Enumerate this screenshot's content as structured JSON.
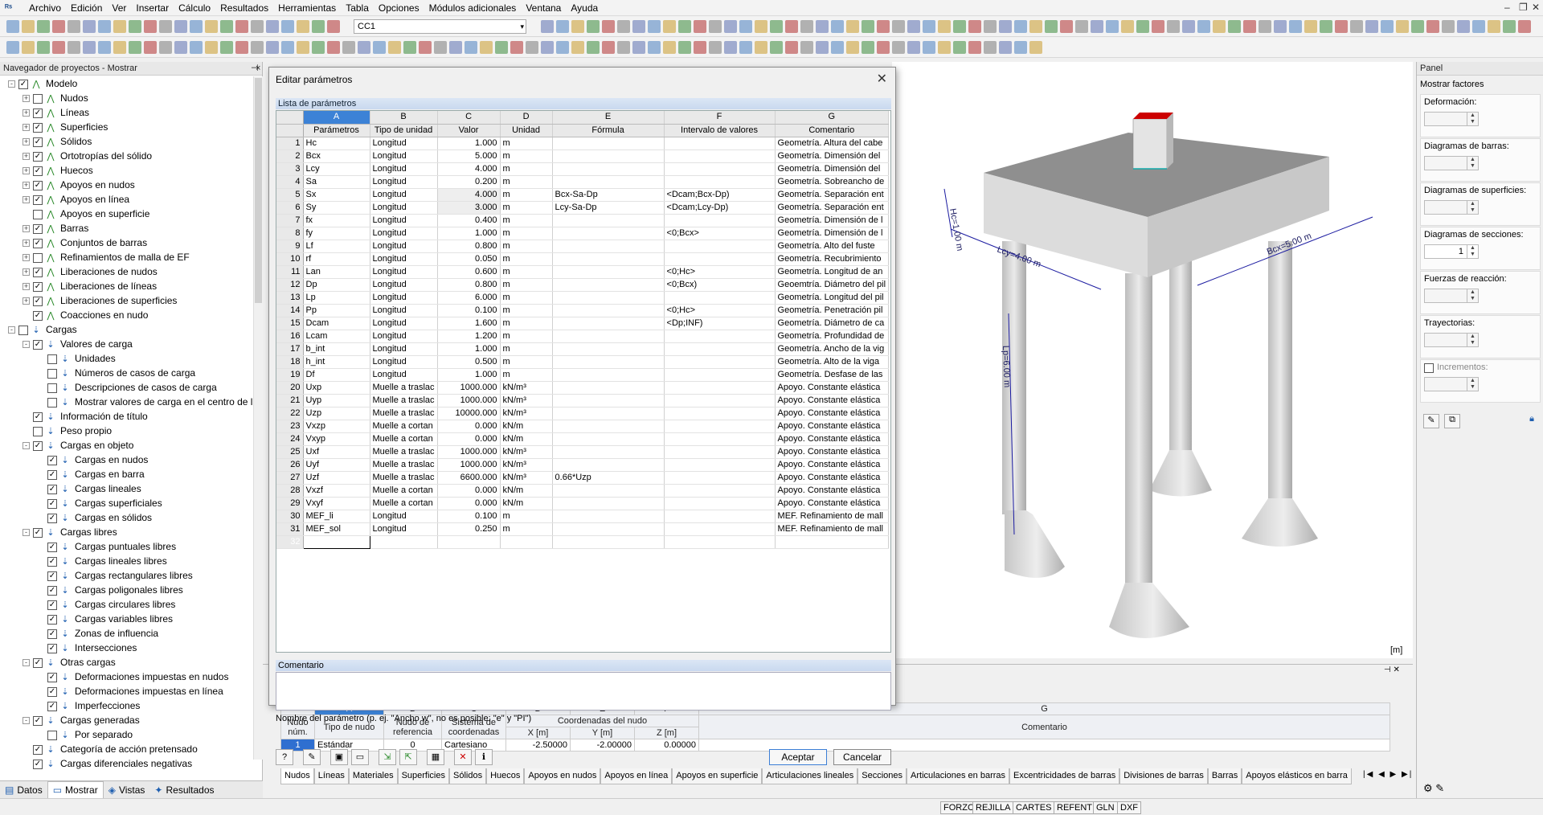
{
  "menu": {
    "items": [
      "Archivo",
      "Edición",
      "Ver",
      "Insertar",
      "Cálculo",
      "Resultados",
      "Herramientas",
      "Tabla",
      "Opciones",
      "Módulos adicionales",
      "Ventana",
      "Ayuda"
    ]
  },
  "toolbar": {
    "load_case": "CC1"
  },
  "nav": {
    "title": "Navegador de proyectos - Mostrar",
    "items": [
      {
        "l": "Modelo",
        "lv": 0,
        "e": "-",
        "c": "✓",
        "ic": "gr"
      },
      {
        "l": "Nudos",
        "lv": 1,
        "e": "+",
        "c": "",
        "ic": "gr"
      },
      {
        "l": "Líneas",
        "lv": 1,
        "e": "+",
        "c": "✓",
        "ic": "gr"
      },
      {
        "l": "Superficies",
        "lv": 1,
        "e": "+",
        "c": "✓",
        "ic": "gr"
      },
      {
        "l": "Sólidos",
        "lv": 1,
        "e": "+",
        "c": "✓",
        "ic": "gr"
      },
      {
        "l": "Ortotropías del sólido",
        "lv": 1,
        "e": "+",
        "c": "✓",
        "ic": "gr"
      },
      {
        "l": "Huecos",
        "lv": 1,
        "e": "+",
        "c": "✓",
        "ic": "gr"
      },
      {
        "l": "Apoyos en nudos",
        "lv": 1,
        "e": "+",
        "c": "✓",
        "ic": "gr"
      },
      {
        "l": "Apoyos en línea",
        "lv": 1,
        "e": "+",
        "c": "✓",
        "ic": "gr"
      },
      {
        "l": "Apoyos en superficie",
        "lv": 1,
        "e": "",
        "c": "",
        "ic": "gr"
      },
      {
        "l": "Barras",
        "lv": 1,
        "e": "+",
        "c": "✓",
        "ic": "gr"
      },
      {
        "l": "Conjuntos de barras",
        "lv": 1,
        "e": "+",
        "c": "✓",
        "ic": "gr"
      },
      {
        "l": "Refinamientos de malla de EF",
        "lv": 1,
        "e": "+",
        "c": "",
        "ic": "gr"
      },
      {
        "l": "Liberaciones de nudos",
        "lv": 1,
        "e": "+",
        "c": "✓",
        "ic": "gr"
      },
      {
        "l": "Liberaciones de líneas",
        "lv": 1,
        "e": "+",
        "c": "✓",
        "ic": "gr"
      },
      {
        "l": "Liberaciones de superficies",
        "lv": 1,
        "e": "+",
        "c": "✓",
        "ic": "gr"
      },
      {
        "l": "Coacciones en nudo",
        "lv": 1,
        "e": "",
        "c": "✓",
        "ic": "gr"
      },
      {
        "l": "Cargas",
        "lv": 0,
        "e": "-",
        "c": "",
        "ic": "bl"
      },
      {
        "l": "Valores de carga",
        "lv": 1,
        "e": "-",
        "c": "✓",
        "ic": "bl"
      },
      {
        "l": "Unidades",
        "lv": 2,
        "e": "",
        "c": "",
        "ic": "bl"
      },
      {
        "l": "Números de casos de carga",
        "lv": 2,
        "e": "",
        "c": "",
        "ic": "bl"
      },
      {
        "l": "Descripciones de casos de carga",
        "lv": 2,
        "e": "",
        "c": "",
        "ic": "bl"
      },
      {
        "l": "Mostrar valores de carga en el centro de la",
        "lv": 2,
        "e": "",
        "c": "",
        "ic": "bl"
      },
      {
        "l": "Información de título",
        "lv": 1,
        "e": "",
        "c": "✓",
        "ic": "bl"
      },
      {
        "l": "Peso propio",
        "lv": 1,
        "e": "",
        "c": "",
        "ic": "bl"
      },
      {
        "l": "Cargas en objeto",
        "lv": 1,
        "e": "-",
        "c": "✓",
        "ic": "bl"
      },
      {
        "l": "Cargas en nudos",
        "lv": 2,
        "e": "",
        "c": "✓",
        "ic": "bl"
      },
      {
        "l": "Cargas en barra",
        "lv": 2,
        "e": "",
        "c": "✓",
        "ic": "bl"
      },
      {
        "l": "Cargas lineales",
        "lv": 2,
        "e": "",
        "c": "✓",
        "ic": "bl"
      },
      {
        "l": "Cargas superficiales",
        "lv": 2,
        "e": "",
        "c": "✓",
        "ic": "bl"
      },
      {
        "l": "Cargas en sólidos",
        "lv": 2,
        "e": "",
        "c": "✓",
        "ic": "bl"
      },
      {
        "l": "Cargas libres",
        "lv": 1,
        "e": "-",
        "c": "✓",
        "ic": "bl"
      },
      {
        "l": "Cargas puntuales libres",
        "lv": 2,
        "e": "",
        "c": "✓",
        "ic": "bl"
      },
      {
        "l": "Cargas lineales libres",
        "lv": 2,
        "e": "",
        "c": "✓",
        "ic": "bl"
      },
      {
        "l": "Cargas rectangulares libres",
        "lv": 2,
        "e": "",
        "c": "✓",
        "ic": "bl"
      },
      {
        "l": "Cargas poligonales libres",
        "lv": 2,
        "e": "",
        "c": "✓",
        "ic": "bl"
      },
      {
        "l": "Cargas circulares libres",
        "lv": 2,
        "e": "",
        "c": "✓",
        "ic": "bl"
      },
      {
        "l": "Cargas variables libres",
        "lv": 2,
        "e": "",
        "c": "✓",
        "ic": "bl"
      },
      {
        "l": "Zonas de influencia",
        "lv": 2,
        "e": "",
        "c": "✓",
        "ic": "bl"
      },
      {
        "l": "Intersecciones",
        "lv": 2,
        "e": "",
        "c": "✓",
        "ic": "bl"
      },
      {
        "l": "Otras cargas",
        "lv": 1,
        "e": "-",
        "c": "✓",
        "ic": "bl"
      },
      {
        "l": "Deformaciones impuestas en nudos",
        "lv": 2,
        "e": "",
        "c": "✓",
        "ic": "bl"
      },
      {
        "l": "Deformaciones impuestas en línea",
        "lv": 2,
        "e": "",
        "c": "✓",
        "ic": "bl"
      },
      {
        "l": "Imperfecciones",
        "lv": 2,
        "e": "",
        "c": "✓",
        "ic": "bl"
      },
      {
        "l": "Cargas generadas",
        "lv": 1,
        "e": "-",
        "c": "✓",
        "ic": "bl"
      },
      {
        "l": "Por separado",
        "lv": 2,
        "e": "",
        "c": "",
        "ic": "bl"
      },
      {
        "l": "Categoría de acción pretensado",
        "lv": 1,
        "e": "",
        "c": "✓",
        "ic": "bl"
      },
      {
        "l": "Cargas diferenciales negativas",
        "lv": 1,
        "e": "",
        "c": "✓",
        "ic": "bl"
      }
    ],
    "tabs": [
      "Datos",
      "Mostrar",
      "Vistas",
      "Resultados"
    ]
  },
  "dialog": {
    "title": "Editar parámetros",
    "list_header": "Lista de parámetros",
    "col_letters": [
      "A",
      "B",
      "C",
      "D",
      "E",
      "F",
      "G"
    ],
    "col_names": [
      "Parámetros",
      "Tipo de unidad",
      "Valor",
      "Unidad",
      "Fórmula",
      "Intervalo de valores",
      "Comentario"
    ],
    "rows": [
      [
        "1",
        "Hc",
        "Longitud",
        "1.000",
        "m",
        "",
        "",
        "Geometría. Altura del cabe"
      ],
      [
        "2",
        "Bcx",
        "Longitud",
        "5.000",
        "m",
        "",
        "",
        "Geometría. Dimensión del"
      ],
      [
        "3",
        "Lcy",
        "Longitud",
        "4.000",
        "m",
        "",
        "",
        "Geometría. Dimensión del"
      ],
      [
        "4",
        "Sa",
        "Longitud",
        "0.200",
        "m",
        "",
        "",
        "Geometría. Sobreancho de"
      ],
      [
        "5",
        "Sx",
        "Longitud",
        "4.000",
        "m",
        "Bcx-Sa-Dp",
        "<Dcam;Bcx-Dp)",
        "Geometría. Separación ent"
      ],
      [
        "6",
        "Sy",
        "Longitud",
        "3.000",
        "m",
        "Lcy-Sa-Dp",
        "<Dcam;Lcy-Dp)",
        "Geometría. Separación ent"
      ],
      [
        "7",
        "fx",
        "Longitud",
        "0.400",
        "m",
        "",
        "",
        "Geometría. Dimensión de l"
      ],
      [
        "8",
        "fy",
        "Longitud",
        "1.000",
        "m",
        "",
        "<0;Bcx>",
        "Geometría. Dimensión de l"
      ],
      [
        "9",
        "Lf",
        "Longitud",
        "0.800",
        "m",
        "",
        "",
        "Geometría. Alto del fuste"
      ],
      [
        "10",
        "rf",
        "Longitud",
        "0.050",
        "m",
        "",
        "",
        "Geometría. Recubrimiento"
      ],
      [
        "11",
        "Lan",
        "Longitud",
        "0.600",
        "m",
        "",
        "<0;Hc>",
        "Geometría. Longitud de an"
      ],
      [
        "12",
        "Dp",
        "Longitud",
        "0.800",
        "m",
        "",
        "<0;Bcx)",
        "Geoemtría. Diámetro del pil"
      ],
      [
        "13",
        "Lp",
        "Longitud",
        "6.000",
        "m",
        "",
        "",
        "Geometría. Longitud del pil"
      ],
      [
        "14",
        "Pp",
        "Longitud",
        "0.100",
        "m",
        "",
        "<0;Hc>",
        "Geometría. Penetración pil"
      ],
      [
        "15",
        "Dcam",
        "Longitud",
        "1.600",
        "m",
        "",
        "<Dp;INF)",
        "Geometría. Diámetro de ca"
      ],
      [
        "16",
        "Lcam",
        "Longitud",
        "1.200",
        "m",
        "",
        "",
        "Geometría. Profundidad de"
      ],
      [
        "17",
        "b_int",
        "Longitud",
        "1.000",
        "m",
        "",
        "",
        "Geometría. Ancho de la vig"
      ],
      [
        "18",
        "h_int",
        "Longitud",
        "0.500",
        "m",
        "",
        "",
        "Geometría. Alto de la viga"
      ],
      [
        "19",
        "Df",
        "Longitud",
        "1.000",
        "m",
        "",
        "",
        "Geometría. Desfase de las"
      ],
      [
        "20",
        "Uxp",
        "Muelle a traslac",
        "1000.000",
        "kN/m³",
        "",
        "",
        "Apoyo. Constante elástica"
      ],
      [
        "21",
        "Uyp",
        "Muelle a traslac",
        "1000.000",
        "kN/m³",
        "",
        "",
        "Apoyo. Constante elástica"
      ],
      [
        "22",
        "Uzp",
        "Muelle a traslac",
        "10000.000",
        "kN/m³",
        "",
        "",
        "Apoyo. Constante elástica"
      ],
      [
        "23",
        "Vxzp",
        "Muelle a cortan",
        "0.000",
        "kN/m",
        "",
        "",
        "Apoyo. Constante elástica"
      ],
      [
        "24",
        "Vxyp",
        "Muelle a cortan",
        "0.000",
        "kN/m",
        "",
        "",
        "Apoyo. Constante elástica"
      ],
      [
        "25",
        "Uxf",
        "Muelle a traslac",
        "1000.000",
        "kN/m³",
        "",
        "",
        "Apoyo. Constante elástica"
      ],
      [
        "26",
        "Uyf",
        "Muelle a traslac",
        "1000.000",
        "kN/m³",
        "",
        "",
        "Apoyo. Constante elástica"
      ],
      [
        "27",
        "Uzf",
        "Muelle a traslac",
        "6600.000",
        "kN/m³",
        "0.66*Uzp",
        "",
        "Apoyo. Constante elástica"
      ],
      [
        "28",
        "Vxzf",
        "Muelle a cortan",
        "0.000",
        "kN/m",
        "",
        "",
        "Apoyo. Constante elástica"
      ],
      [
        "29",
        "Vxyf",
        "Muelle a cortan",
        "0.000",
        "kN/m",
        "",
        "",
        "Apoyo. Constante elástica"
      ],
      [
        "30",
        "MEF_li",
        "Longitud",
        "0.100",
        "m",
        "",
        "",
        "MEF. Refinamiento de mall"
      ],
      [
        "31",
        "MEF_sol",
        "Longitud",
        "0.250",
        "m",
        "",
        "",
        "MEF. Refinamiento de mall"
      ],
      [
        "32",
        "",
        "",
        "",
        "",
        "",
        "",
        ""
      ]
    ],
    "comment_header": "Comentario",
    "hint": "Nombre del parámetro (p. ej. \"Ancho w\", no es posible: \"e\" y \"PI\")",
    "ok": "Aceptar",
    "cancel": "Cancelar"
  },
  "view": {
    "dims": {
      "hc": "Hc=1.00 m",
      "lcy": "Lcy=4.00 m",
      "bcx": "Bcx=5.00 m",
      "lp": "Lp=6.00 m"
    },
    "units": "[m]"
  },
  "panel": {
    "title": "Panel",
    "subtitle": "Mostrar factores",
    "sections": [
      {
        "label": "Deformación:",
        "value": ""
      },
      {
        "label": "Diagramas de barras:",
        "value": ""
      },
      {
        "label": "Diagramas de superficies:",
        "value": ""
      },
      {
        "label": "Diagramas de secciones:",
        "value": "1"
      },
      {
        "label": "Fuerzas de reacción:",
        "value": ""
      },
      {
        "label": "Trayectorias:",
        "value": ""
      },
      {
        "label": "Incrementos:",
        "value": ""
      }
    ]
  },
  "node_table": {
    "col_letters": [
      "A",
      "B",
      "C",
      "D",
      "E",
      "F",
      "G"
    ],
    "h1": [
      "Nudo núm.",
      "Tipo de nudo",
      "Nudo de referencia",
      "Sistema de coordenadas",
      "Coordenadas del nudo",
      "Comentario"
    ],
    "h2": [
      "X [m]",
      "Y [m]",
      "Z [m]"
    ],
    "row": [
      "1",
      "Estándar",
      "0",
      "Cartesiano",
      "-2.50000",
      "-2.00000",
      "0.00000",
      ""
    ]
  },
  "bottom_tabs": [
    "Nudos",
    "Líneas",
    "Materiales",
    "Superficies",
    "Sólidos",
    "Huecos",
    "Apoyos en nudos",
    "Apoyos en línea",
    "Apoyos en superficie",
    "Articulaciones lineales",
    "Secciones",
    "Articulaciones en barras",
    "Excentricidades de barras",
    "Divisiones de barras",
    "Barras",
    "Apoyos elásticos en barra"
  ],
  "status": [
    "FORZC",
    "REJILLA",
    "CARTES",
    "REFENT",
    "GLN",
    "DXF"
  ]
}
